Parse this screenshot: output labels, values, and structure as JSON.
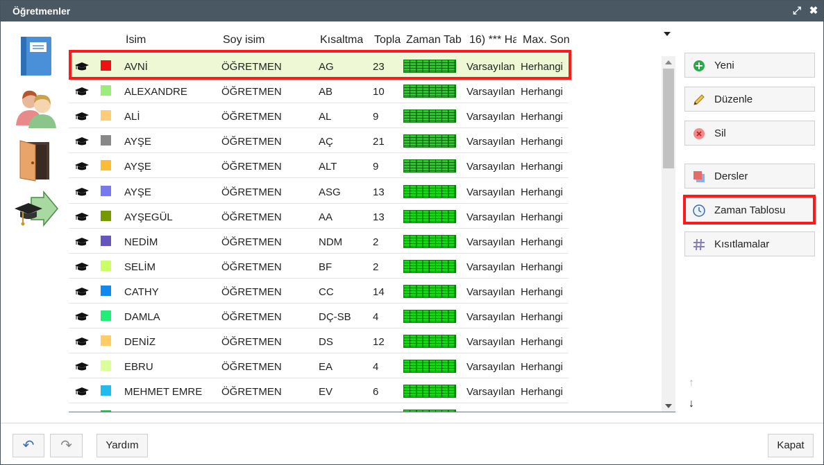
{
  "window": {
    "title": "Öğretmenler",
    "maximize_icon": "⤢",
    "close_icon": "✖"
  },
  "side_icons": [
    "book-icon",
    "people-icon",
    "door-icon",
    "graduation-arrow-icon"
  ],
  "table": {
    "columns": [
      "İsim",
      "Soy isim",
      "Kısaltma",
      "Topla",
      "Zaman Tab",
      "16) *** Ha",
      "Max. Son"
    ],
    "rows": [
      {
        "name": "AVNİ",
        "surname": "ÖĞRETMEN",
        "abbr": "AG",
        "total": "23",
        "color": "#ee1111",
        "default": "Varsayılan",
        "max": "Herhangi"
      },
      {
        "name": "ALEXANDRE",
        "surname": "ÖĞRETMEN",
        "abbr": "AB",
        "total": "10",
        "color": "#99ee77",
        "default": "Varsayılan",
        "max": "Herhangi"
      },
      {
        "name": "ALİ",
        "surname": "ÖĞRETMEN",
        "abbr": "AL",
        "total": "9",
        "color": "#ffcc77",
        "default": "Varsayılan",
        "max": "Herhangi"
      },
      {
        "name": "AYŞE",
        "surname": "ÖĞRETMEN",
        "abbr": "AÇ",
        "total": "21",
        "color": "#888888",
        "default": "Varsayılan",
        "max": "Herhangi"
      },
      {
        "name": "AYŞE",
        "surname": "ÖĞRETMEN",
        "abbr": "ALT",
        "total": "9",
        "color": "#ffbb33",
        "default": "Varsayılan",
        "max": "Herhangi"
      },
      {
        "name": "AYŞE",
        "surname": "ÖĞRETMEN",
        "abbr": "ASG",
        "total": "13",
        "color": "#7777ee",
        "default": "Varsayılan",
        "max": "Herhangi"
      },
      {
        "name": "AYŞEGÜL",
        "surname": "ÖĞRETMEN",
        "abbr": "AA",
        "total": "13",
        "color": "#779900",
        "default": "Varsayılan",
        "max": "Herhangi"
      },
      {
        "name": "NEDİM",
        "surname": "ÖĞRETMEN",
        "abbr": "NDM",
        "total": "2",
        "color": "#6655bb",
        "default": "Varsayılan",
        "max": "Herhangi"
      },
      {
        "name": "SELİM",
        "surname": "ÖĞRETMEN",
        "abbr": "BF",
        "total": "2",
        "color": "#ccff66",
        "default": "Varsayılan",
        "max": "Herhangi"
      },
      {
        "name": "CATHY",
        "surname": "ÖĞRETMEN",
        "abbr": "CC",
        "total": "14",
        "color": "#1188ee",
        "default": "Varsayılan",
        "max": "Herhangi"
      },
      {
        "name": "DAMLA",
        "surname": "ÖĞRETMEN",
        "abbr": "DÇ-SB",
        "total": "4",
        "color": "#22ee77",
        "default": "Varsayılan",
        "max": "Herhangi"
      },
      {
        "name": "DENİZ",
        "surname": "ÖĞRETMEN",
        "abbr": "DS",
        "total": "12",
        "color": "#ffcc66",
        "default": "Varsayılan",
        "max": "Herhangi"
      },
      {
        "name": "EBRU",
        "surname": "ÖĞRETMEN",
        "abbr": "EA",
        "total": "4",
        "color": "#ddff99",
        "default": "Varsayılan",
        "max": "Herhangi"
      },
      {
        "name": "MEHMET EMRE",
        "surname": "ÖĞRETMEN",
        "abbr": "EV",
        "total": "6",
        "color": "#22bbee",
        "default": "Varsayılan",
        "max": "Herhangi"
      },
      {
        "name": "",
        "surname": "",
        "abbr": "",
        "total": "",
        "color": "#22cc44",
        "default": "",
        "max": ""
      }
    ]
  },
  "actions": {
    "new": "Yeni",
    "edit": "Düzenle",
    "delete": "Sil",
    "lessons": "Dersler",
    "timetable": "Zaman Tablosu",
    "constraints": "Kısıtlamalar"
  },
  "move": {
    "up_icon": "↑",
    "down_icon": "↓"
  },
  "footer": {
    "help": "Yardım",
    "close": "Kapat",
    "undo_icon": "↶",
    "redo_icon": "↷"
  },
  "colors": {
    "titlebar": "#4a5863",
    "selection_outline": "#ff1a1a",
    "selected_row": "#eef8d4",
    "timetable_green": "#1bd31b"
  }
}
